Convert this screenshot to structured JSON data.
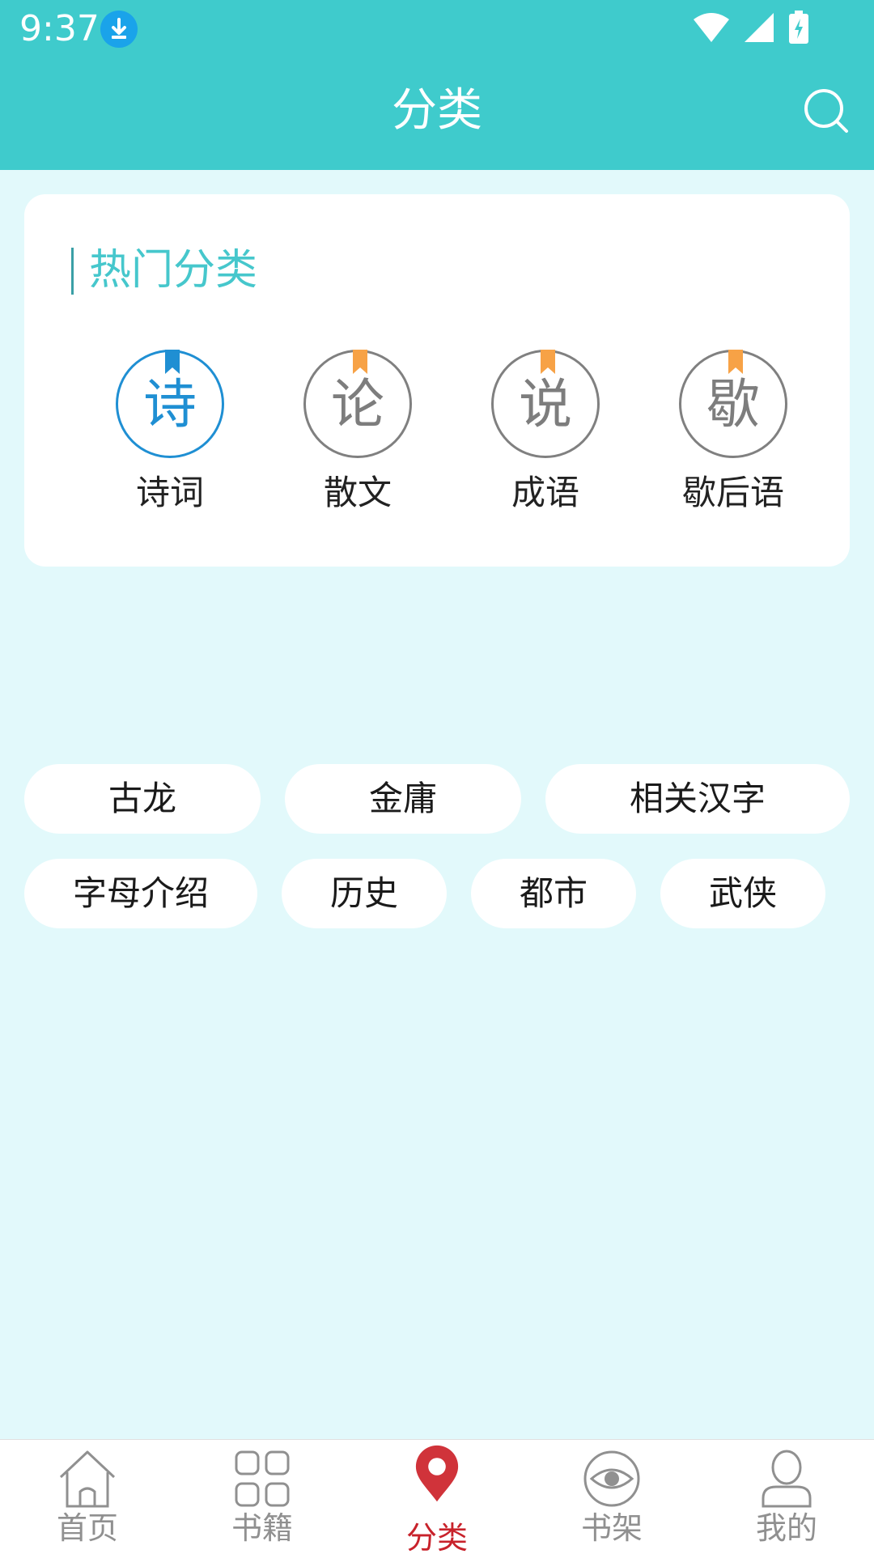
{
  "status_bar": {
    "time": "9:37"
  },
  "header": {
    "title": "分类"
  },
  "hot_section": {
    "title": "热门分类",
    "items": [
      {
        "glyph": "诗",
        "label": "诗词"
      },
      {
        "glyph": "论",
        "label": "散文"
      },
      {
        "glyph": "说",
        "label": "成语"
      },
      {
        "glyph": "歇",
        "label": "歇后语"
      }
    ]
  },
  "tags": [
    "古龙",
    "金庸",
    "相关汉字",
    "字母介绍",
    "历史",
    "都市",
    "武侠"
  ],
  "bottom_nav": {
    "items": [
      {
        "label": "首页"
      },
      {
        "label": "书籍"
      },
      {
        "label": "分类"
      },
      {
        "label": "书架"
      },
      {
        "label": "我的"
      }
    ],
    "active": "分类"
  },
  "colors": {
    "accent": "#3fcbcc",
    "active_blue": "#1f8fd3",
    "ribbon_orange": "#f7a246",
    "nav_active_red": "#c8222b",
    "background": "#e2f9fb"
  }
}
